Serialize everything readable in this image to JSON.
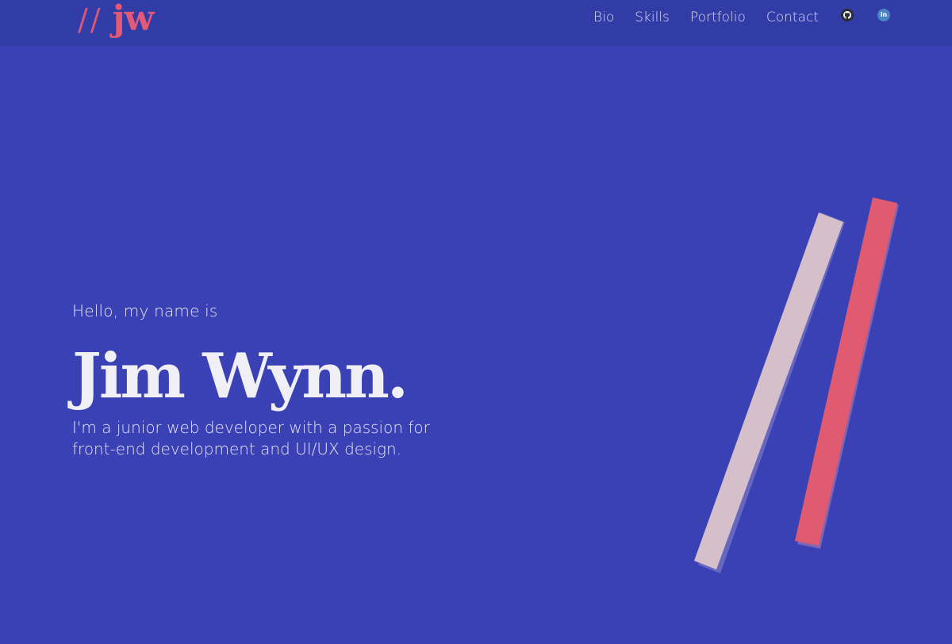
{
  "header": {
    "logo": {
      "slashes": "//",
      "initials": "jw"
    },
    "nav": {
      "items": [
        "Bio",
        "Skills",
        "Portfolio",
        "Contact"
      ],
      "github_icon": "github-icon",
      "linkedin_icon": "linkedin-icon",
      "linkedin_text": "in"
    }
  },
  "hero": {
    "greeting": "Hello, my name is",
    "name": "Jim Wynn.",
    "tagline": "I'm a junior web developer with a passion for front-end development and UI/UX design."
  },
  "colors": {
    "background": "#3941b4",
    "header_background": "#323ca6",
    "accent": "#e05a78",
    "bar_light": "#d4bfcb",
    "bar_accent": "#e05a70"
  }
}
